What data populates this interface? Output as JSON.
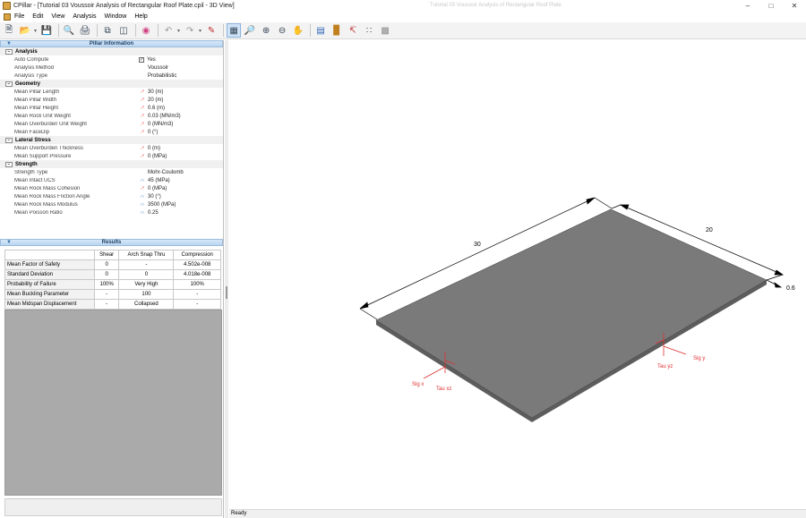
{
  "titlebar": {
    "title": "CPillar - [Tutorial 03 Voussoir Analysis of Rectangular Roof Plate.cpil - 3D View]",
    "ghost_text": "Tutorial 03 Voussoir Analysis of Rectangular Roof Plate"
  },
  "menu": [
    "File",
    "Edit",
    "View",
    "Analysis",
    "Window",
    "Help"
  ],
  "toolbar": {
    "icons": [
      "new-file-icon",
      "open-folder-icon",
      "save-icon",
      "print-preview-icon",
      "print-icon",
      "copy-icon",
      "split-view-icon",
      "color-wheel-icon",
      "undo-icon",
      "redo-icon",
      "edit-wand-icon",
      "select-page-icon",
      "zoom-extents-icon",
      "zoom-in-icon",
      "zoom-out-icon",
      "pan-hand-icon",
      "bar-chart-icon",
      "histogram-icon",
      "line-chart-icon",
      "scatter-icon",
      "dialog-icon"
    ]
  },
  "pillar_info": {
    "title": "Pillar Information",
    "categories": [
      {
        "name": "Analysis",
        "rows": [
          {
            "name": "Auto Compute",
            "value": "Yes",
            "icon": "checkbox"
          },
          {
            "name": "Analysis Method",
            "value": "Voussoir",
            "icon": ""
          },
          {
            "name": "Analysis Type",
            "value": "Probabilistic",
            "icon": ""
          }
        ]
      },
      {
        "name": "Geometry",
        "rows": [
          {
            "name": "Mean Pillar Length",
            "value": "30 (m)",
            "icon": "dim"
          },
          {
            "name": "Mean Pillar Width",
            "value": "20 (m)",
            "icon": "dim"
          },
          {
            "name": "Mean Pillar Height",
            "value": "0.6 (m)",
            "icon": "dim"
          },
          {
            "name": "Mean Rock Unit Weight",
            "value": "0.03 (MN/m3)",
            "icon": "dim"
          },
          {
            "name": "Mean Overburden Unit Weight",
            "value": "0 (MN/m3)",
            "icon": "dim"
          },
          {
            "name": "Mean FaceDip",
            "value": "0 (°)",
            "icon": "dim"
          }
        ]
      },
      {
        "name": "Lateral Stress",
        "rows": [
          {
            "name": "Mean Overburden Thickness",
            "value": "0 (m)",
            "icon": "dim"
          },
          {
            "name": "Mean Support Pressure",
            "value": "0 (MPa)",
            "icon": "dim"
          }
        ]
      },
      {
        "name": "Strength",
        "rows": [
          {
            "name": "Strength Type",
            "value": "Mohr-Coulomb",
            "icon": ""
          },
          {
            "name": "Mean Intact UCS",
            "value": "45 (MPa)",
            "icon": "dist"
          },
          {
            "name": "Mean Rock Mass Cohesion",
            "value": "0 (MPa)",
            "icon": "dim"
          },
          {
            "name": "Mean Rock Mass Friction Angle",
            "value": "30 (°)",
            "icon": "dist"
          },
          {
            "name": "Mean Rock Mass Modulus",
            "value": "3500 (MPa)",
            "icon": "dist"
          },
          {
            "name": "Mean Poisson Ratio",
            "value": "0.25",
            "icon": "dist"
          }
        ]
      }
    ]
  },
  "results": {
    "title": "Results",
    "columns": [
      "",
      "Shear",
      "Arch Snap Thru",
      "Compression"
    ],
    "rows": [
      [
        "Mean Factor of Safety",
        "0",
        "-",
        "4.502e-008"
      ],
      [
        "Standard Deviation",
        "0",
        "0",
        "4.018e-008"
      ],
      [
        "Probability of Failure",
        "100%",
        "Very High",
        "100%"
      ],
      [
        "Mean Buckling Parameter",
        "-",
        "100",
        "-"
      ],
      [
        "Mean Midspan Displacement",
        "-",
        "Collapsed",
        "-"
      ]
    ]
  },
  "view3d": {
    "dim_length": "30",
    "dim_width": "20",
    "dim_thickness": "0.6",
    "label_sig_x": "Sig x",
    "label_tau_xz": "Tau xz",
    "label_sig_y": "Sig y",
    "label_tau_yz": "Tau yz",
    "plate_top_color": "#7a7a7a",
    "plate_side_color": "#5d5d5d",
    "stress_color": "#e03030"
  },
  "status": {
    "text": "Ready"
  }
}
